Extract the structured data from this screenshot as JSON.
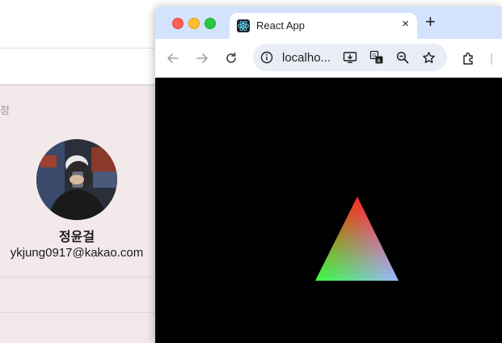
{
  "background_app": {
    "section_label": "정",
    "profile": {
      "name": "정윤걸",
      "email": "ykjung0917@kakao.com"
    }
  },
  "browser": {
    "tab": {
      "title": "React App",
      "close_glyph": "×",
      "favicon": "react-logo-icon"
    },
    "new_tab_glyph": "+",
    "address_bar": {
      "url": "localho..."
    },
    "toolbar_icons": [
      "back-arrow-icon",
      "forward-arrow-icon",
      "reload-icon",
      "site-info-icon",
      "install-app-icon",
      "translate-icon",
      "zoom-out-icon",
      "bookmark-star-icon",
      "extensions-icon"
    ],
    "viewport": {
      "background": "#000000",
      "triangle_vertex_colors": [
        "#ff2a2a",
        "#33ff33",
        "#2a2aff"
      ]
    }
  },
  "colors": {
    "tab_strip": "#d3e3fd",
    "profile_panel": "#f3e9ea"
  }
}
